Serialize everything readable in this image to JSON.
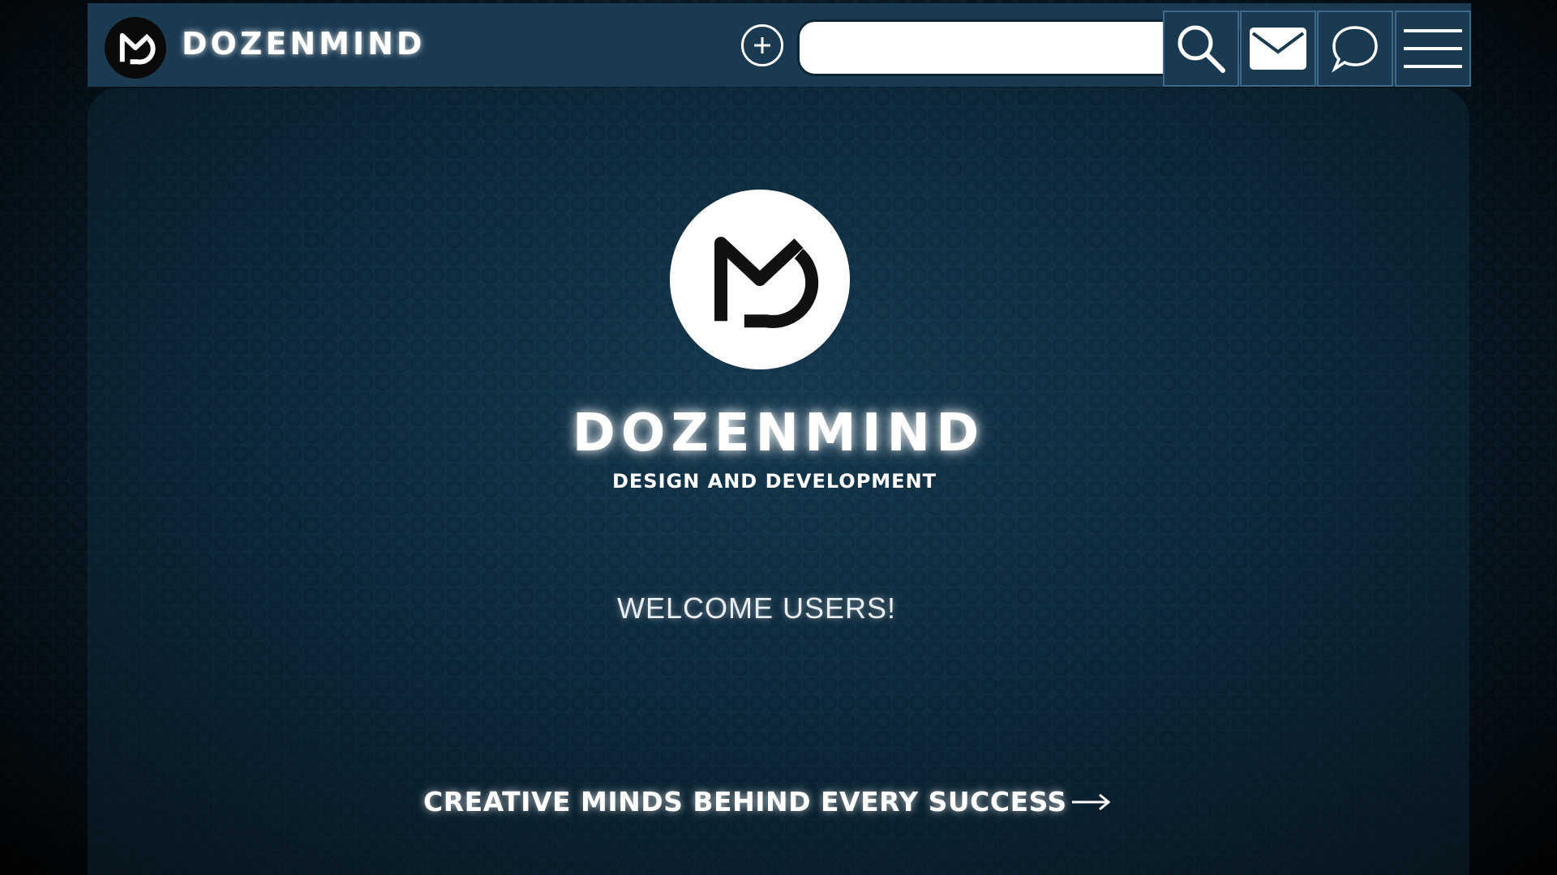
{
  "header": {
    "brand_name": "DOZENMIND",
    "search": {
      "value": "",
      "placeholder": ""
    },
    "icons": [
      "plus-circle-icon",
      "search-icon",
      "mail-icon",
      "chat-icon",
      "hamburger-menu-icon"
    ]
  },
  "hero": {
    "title": "DOZENMIND",
    "subtitle": "DESIGN AND DEVELOPMENT",
    "welcome": "WELCOME USERS!",
    "cta_label": "CREATIVE MINDS BEHIND EVERY SUCCESS"
  },
  "colors": {
    "header_bg": "#1a3a52",
    "text": "#ffffff",
    "page_bg": "#0c2535"
  }
}
